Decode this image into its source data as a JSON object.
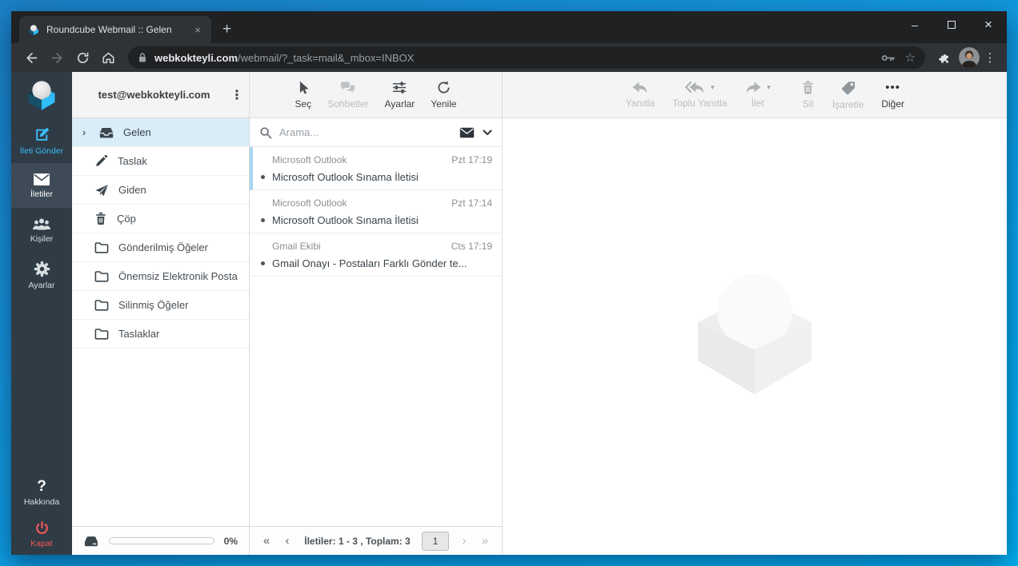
{
  "browser": {
    "tab_title": "Roundcube Webmail :: Gelen",
    "url": {
      "domain": "webkokteyli.com",
      "path": "/webmail/?_task=mail&_mbox=INBOX"
    }
  },
  "icons": {
    "minimize": "–",
    "close": "×",
    "tab_close": "×",
    "new_tab": "+",
    "menu": "⋮",
    "kebab": "⋮",
    "star": "☆",
    "first": "«",
    "prev": "‹",
    "next": "›",
    "last": "»",
    "chevron": "›",
    "caret": "▾",
    "more": "•••",
    "question": "?"
  },
  "app": {
    "colors": {
      "accent": "#3cbef8",
      "danger": "#f8575c",
      "selection": "#d9edf9",
      "sidebar": "#2f3b45"
    },
    "sidebar": {
      "items": [
        {
          "label": "İleti Gönder"
        },
        {
          "label": "İletiler"
        },
        {
          "label": "Kişiler"
        },
        {
          "label": "Ayarlar"
        }
      ],
      "footer_items": [
        {
          "label": "Hakkında"
        },
        {
          "label": "Kapat"
        }
      ]
    },
    "folders": {
      "account": "test@webkokteyli.com",
      "items": [
        {
          "label": "Gelen",
          "selected": true
        },
        {
          "label": "Taslak"
        },
        {
          "label": "Giden"
        },
        {
          "label": "Çöp"
        },
        {
          "label": "Gönderilmiş Öğeler"
        },
        {
          "label": "Önemsiz Elektronik Posta"
        },
        {
          "label": "Silinmiş Öğeler"
        },
        {
          "label": "Taslaklar"
        }
      ],
      "quota": "0%"
    },
    "list": {
      "toolbar": [
        {
          "label": "Seç"
        },
        {
          "label": "Sohbetler",
          "disabled": true
        },
        {
          "label": "Ayarlar"
        },
        {
          "label": "Yenile"
        }
      ],
      "search_placeholder": "Arama...",
      "messages": [
        {
          "sender": "Microsoft Outlook",
          "date": "Pzt 17:19",
          "subject": "Microsoft Outlook Sınama İletisi",
          "unread": true,
          "focused": true
        },
        {
          "sender": "Microsoft Outlook",
          "date": "Pzt 17:14",
          "subject": "Microsoft Outlook Sınama İletisi",
          "unread": true
        },
        {
          "sender": "Gmail Ekibi",
          "date": "Cts 17:19",
          "subject": "Gmail Onayı - Postaları Farklı Gönder te...",
          "unread": true
        }
      ],
      "pagination": {
        "label": "İletiler: 1 - 3 , Toplam: 3",
        "page": "1"
      }
    },
    "mail": {
      "toolbar": [
        {
          "label": "Yanıtla",
          "disabled": true
        },
        {
          "label": "Toplu Yanıtla",
          "disabled": true,
          "caret": true
        },
        {
          "label": "İlet",
          "disabled": true,
          "caret": true
        },
        {
          "label": "Sil",
          "disabled": true
        },
        {
          "label": "İşaretle",
          "disabled": true
        },
        {
          "label": "Diğer",
          "disabled": false
        }
      ]
    }
  }
}
